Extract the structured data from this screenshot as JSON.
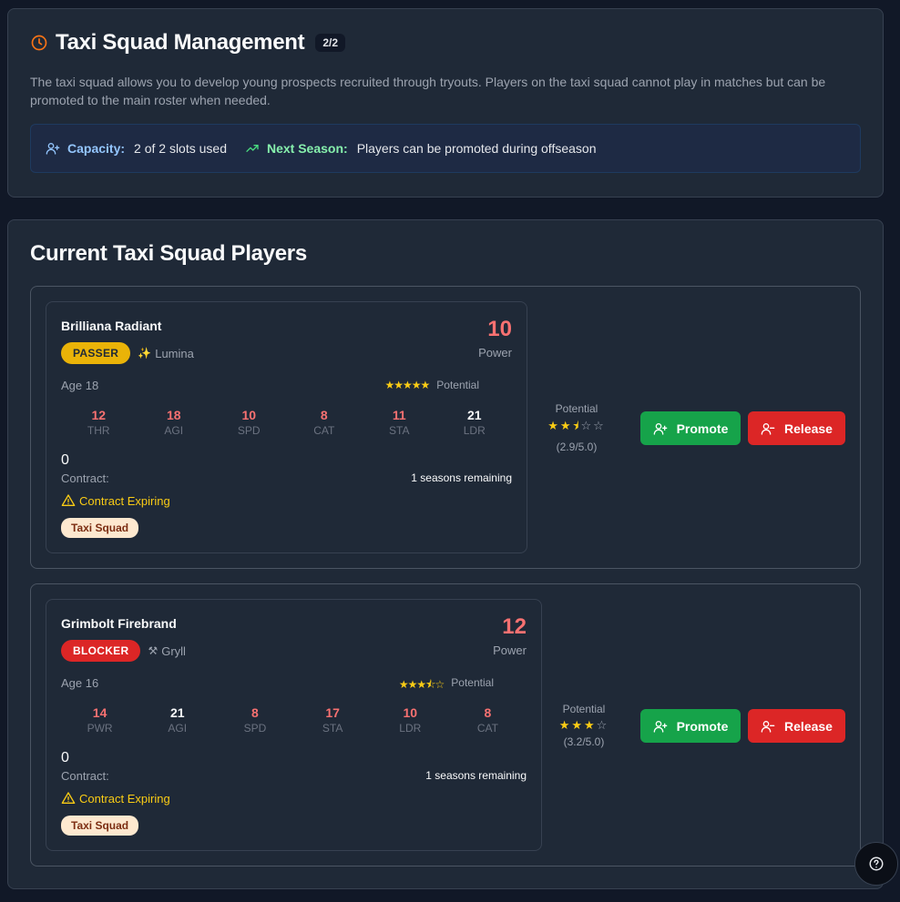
{
  "header": {
    "title": "Taxi Squad Management",
    "count_badge": "2/2",
    "description": "The taxi squad allows you to develop young prospects recruited through tryouts. Players on the taxi squad cannot play in matches but can be promoted to the main roster when needed.",
    "capacity_label": "Capacity:",
    "capacity_value": "2 of 2 slots used",
    "next_season_label": "Next Season:",
    "next_season_value": "Players can be promoted during offseason"
  },
  "section_title": "Current Taxi Squad Players",
  "players": [
    {
      "name": "Brilliana Radiant",
      "role": "PASSER",
      "race": "Lumina",
      "race_icon": "sparkles-icon",
      "power": "10",
      "power_label": "Power",
      "age": "Age 18",
      "mini_stars": "★★★★★",
      "mini_potential_label": "Potential",
      "stats": [
        {
          "value": "12",
          "label": "THR"
        },
        {
          "value": "18",
          "label": "AGI"
        },
        {
          "value": "10",
          "label": "SPD"
        },
        {
          "value": "8",
          "label": "CAT"
        },
        {
          "value": "11",
          "label": "STA"
        },
        {
          "value": "21",
          "label": "LDR"
        }
      ],
      "zero": "0",
      "contract_label": "Contract:",
      "seasons": "1 seasons remaining",
      "expiring": "Contract Expiring",
      "taxi_badge": "Taxi Squad",
      "potential_label": "Potential",
      "potential_stars": 2.9,
      "potential_value": "(2.9/5.0)",
      "promote_label": "Promote",
      "release_label": "Release"
    },
    {
      "name": "Grimbolt Firebrand",
      "role": "BLOCKER",
      "race": "Gryll",
      "race_icon": "hammer-pick-icon",
      "power": "12",
      "power_label": "Power",
      "age": "Age 16",
      "mini_stars": "★★★⯪☆",
      "mini_potential_label": "Potential",
      "stats": [
        {
          "value": "14",
          "label": "PWR"
        },
        {
          "value": "21",
          "label": "AGI"
        },
        {
          "value": "8",
          "label": "SPD"
        },
        {
          "value": "17",
          "label": "STA"
        },
        {
          "value": "10",
          "label": "LDR"
        },
        {
          "value": "8",
          "label": "CAT"
        }
      ],
      "zero": "0",
      "contract_label": "Contract:",
      "seasons": "1 seasons remaining",
      "expiring": "Contract Expiring",
      "taxi_badge": "Taxi Squad",
      "potential_label": "Potential",
      "potential_stars": 3.2,
      "potential_value": "(3.2/5.0)",
      "promote_label": "Promote",
      "release_label": "Release"
    }
  ],
  "colors": {
    "accent_orange": "#f97316",
    "promote_green": "#16a34a",
    "release_red": "#dc2626",
    "star_yellow": "#facc15"
  }
}
